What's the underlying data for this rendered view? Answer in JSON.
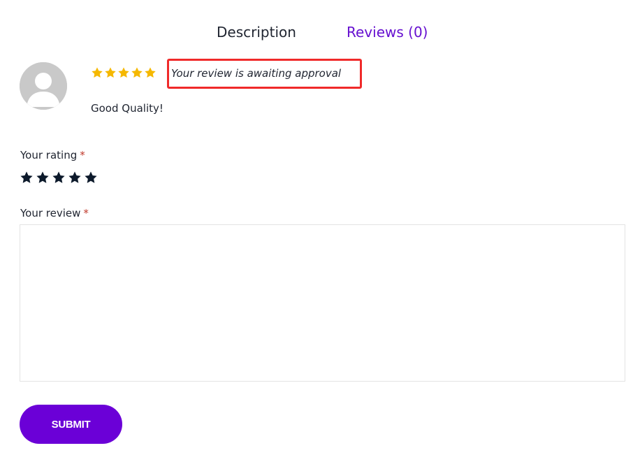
{
  "tabs": [
    {
      "label": "Description",
      "active": false
    },
    {
      "label": "Reviews (0)",
      "active": true
    }
  ],
  "review": {
    "stars": 5,
    "awaiting_text": "Your review is awaiting approval",
    "text": "Good Quality!"
  },
  "form": {
    "rating_label": "Your rating",
    "review_label": "Your review",
    "required_marker": "*",
    "rating_star_count": 5,
    "review_value": "",
    "submit_label": "SUBMIT"
  },
  "icons": {
    "avatar": "user-avatar-icon",
    "review_star": "star-icon",
    "rating_star": "star-icon"
  },
  "colors": {
    "accent": "#6b00d7",
    "active_tab": "#6610d0",
    "review_star": "#f5b800",
    "rating_star": "#0d1a2b",
    "highlight_box": "#f02a2a",
    "required": "#c0392b"
  }
}
